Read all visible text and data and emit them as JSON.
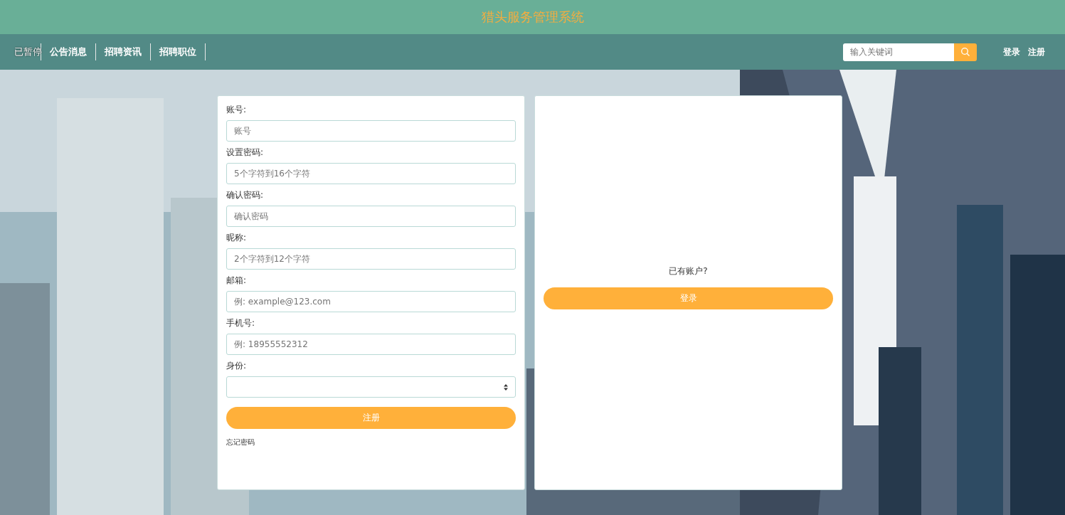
{
  "header": {
    "title": "猎头服务管理系统"
  },
  "video_overlay": {
    "text": "已暂停"
  },
  "nav": {
    "items": [
      {
        "label": "公告消息"
      },
      {
        "label": "招聘资讯"
      },
      {
        "label": "招聘职位"
      }
    ],
    "search": {
      "placeholder": "输入关键词"
    },
    "links": [
      "登录",
      "注册"
    ]
  },
  "form": {
    "fields": [
      {
        "label": "账号:",
        "placeholder": "账号",
        "kind": "input"
      },
      {
        "label": "设置密码:",
        "placeholder": "5个字符到16个字符",
        "kind": "input"
      },
      {
        "label": "确认密码:",
        "placeholder": "确认密码",
        "kind": "input"
      },
      {
        "label": "昵称:",
        "placeholder": "2个字符到12个字符",
        "kind": "input"
      },
      {
        "label": "邮箱:",
        "placeholder": "例: example@123.com",
        "kind": "input"
      },
      {
        "label": "手机号:",
        "placeholder": "例: 18955552312",
        "kind": "input"
      },
      {
        "label": "身份:",
        "kind": "select"
      }
    ],
    "submit": "注册",
    "forgot": "忘记密码"
  },
  "side": {
    "prompt": "已有账户?",
    "button": "登录"
  }
}
